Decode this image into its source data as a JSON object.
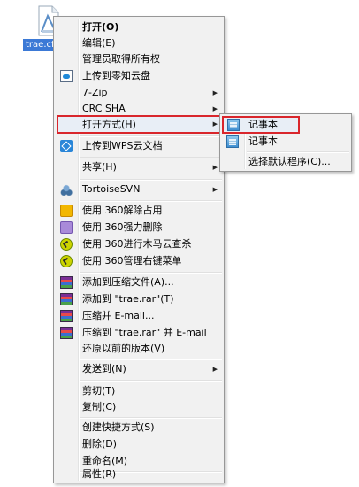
{
  "file": {
    "label": "trae.cfg",
    "icon": "document-icon"
  },
  "menu": {
    "items": [
      {
        "label": "打开(O)",
        "bold": true
      },
      {
        "label": "编辑(E)"
      },
      {
        "label": "管理员取得所有权"
      },
      {
        "label": "上传到零知云盘",
        "icon": "cloud-upload-icon"
      },
      {
        "label": "7-Zip",
        "submenu": true
      },
      {
        "label": "CRC SHA",
        "submenu": true
      },
      {
        "label": "打开方式(H)",
        "submenu": true,
        "highlighted": true
      },
      {
        "label": "上传到WPS云文档",
        "icon": "wps-cloud-icon"
      },
      {
        "label": "共享(H)",
        "submenu": true
      },
      {
        "label": "TortoiseSVN",
        "submenu": true,
        "icon": "tortoisesvn-icon"
      },
      {
        "label": "使用 360解除占用",
        "icon": "360-unlock-icon"
      },
      {
        "label": "使用 360强力删除",
        "icon": "360-force-delete-icon"
      },
      {
        "label": "使用 360进行木马云查杀",
        "icon": "360-trojan-scan-icon"
      },
      {
        "label": "使用 360管理右键菜单",
        "icon": "360-menu-manager-icon"
      },
      {
        "label": "添加到压缩文件(A)...",
        "icon": "winrar-icon"
      },
      {
        "label": "添加到 \"trae.rar\"(T)",
        "icon": "winrar-icon"
      },
      {
        "label": "压缩并 E-mail...",
        "icon": "winrar-icon"
      },
      {
        "label": "压缩到 \"trae.rar\" 并 E-mail",
        "icon": "winrar-icon"
      },
      {
        "label": "还原以前的版本(V)"
      },
      {
        "label": "发送到(N)",
        "submenu": true
      },
      {
        "label": "剪切(T)"
      },
      {
        "label": "复制(C)"
      },
      {
        "label": "创建快捷方式(S)"
      },
      {
        "label": "删除(D)"
      },
      {
        "label": "重命名(M)"
      },
      {
        "label": "属性(R)"
      }
    ]
  },
  "submenu": {
    "items": [
      {
        "label": "记事本",
        "icon": "notepad-icon",
        "highlighted": true
      },
      {
        "label": "记事本",
        "icon": "notepad-icon"
      },
      {
        "label": "选择默认程序(C)..."
      }
    ]
  },
  "colors": {
    "highlight_border": "#d9262c",
    "file_label_bg": "#3b79d6"
  }
}
